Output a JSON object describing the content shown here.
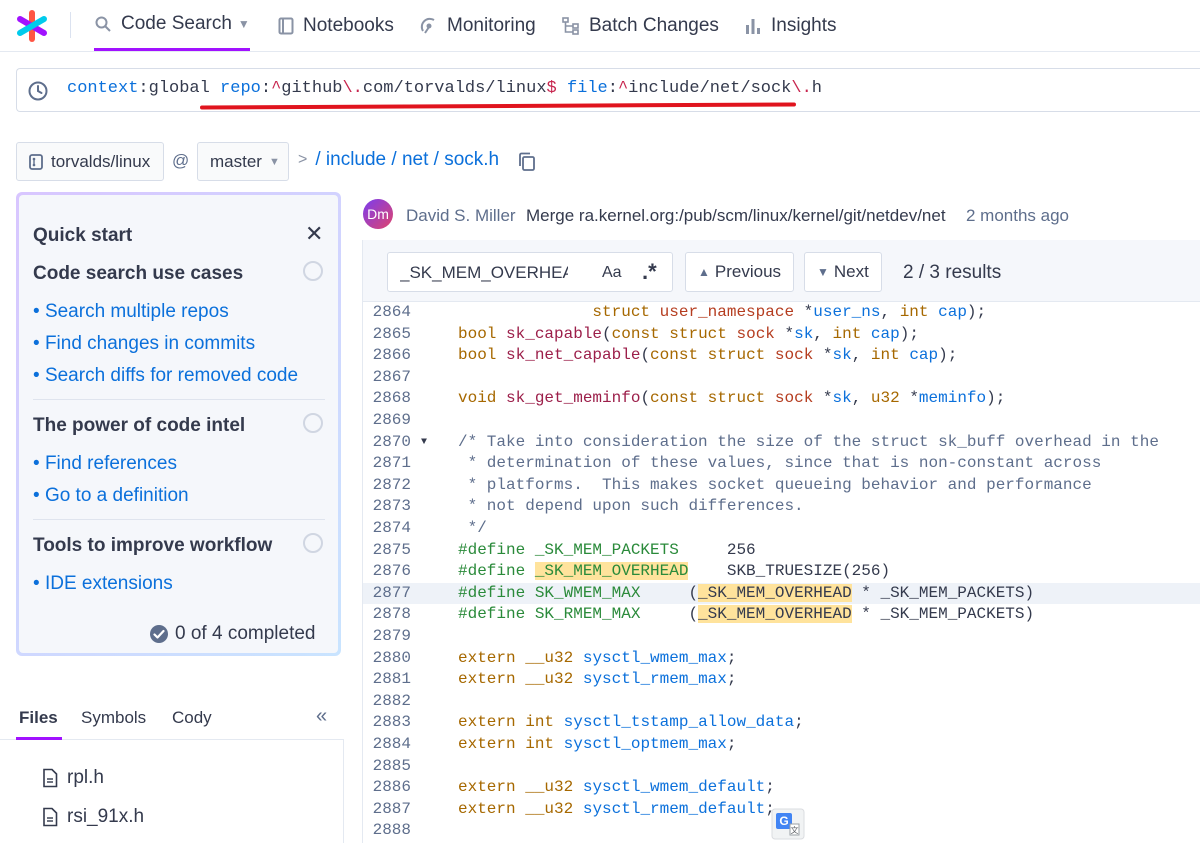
{
  "nav": {
    "items": [
      {
        "label": "Code Search",
        "icon": "search-icon",
        "active": true
      },
      {
        "label": "Notebooks",
        "icon": "notebook-icon"
      },
      {
        "label": "Monitoring",
        "icon": "monitoring-icon"
      },
      {
        "label": "Batch Changes",
        "icon": "batch-changes-icon"
      },
      {
        "label": "Insights",
        "icon": "insights-icon"
      }
    ],
    "accent": "#a112ff"
  },
  "search": {
    "tokens": [
      {
        "text": "context",
        "kind": "key"
      },
      {
        "text": ":global ",
        "kind": "plain"
      },
      {
        "text": "repo",
        "kind": "key"
      },
      {
        "text": ":",
        "kind": "plain"
      },
      {
        "text": "^",
        "kind": "op"
      },
      {
        "text": "github",
        "kind": "plain"
      },
      {
        "text": "\\.",
        "kind": "op"
      },
      {
        "text": "com/torvalds/linux",
        "kind": "plain"
      },
      {
        "text": "$",
        "kind": "op"
      },
      {
        "text": " ",
        "kind": "plain"
      },
      {
        "text": "file",
        "kind": "key"
      },
      {
        "text": ":",
        "kind": "plain"
      },
      {
        "text": "^",
        "kind": "op"
      },
      {
        "text": "include/net/sock",
        "kind": "plain"
      },
      {
        "text": "\\.",
        "kind": "op"
      },
      {
        "text": "h",
        "kind": "plain"
      }
    ]
  },
  "breadcrumb": {
    "repo": "torvalds/linux",
    "at": "@",
    "branch": "master",
    "path": "/ include / net / sock.h"
  },
  "quickstart": {
    "title": "Quick start",
    "sections": [
      {
        "title": "Code search use cases",
        "links": [
          "Search multiple repos",
          "Find changes in commits",
          "Search diffs for removed code"
        ]
      },
      {
        "title": "The power of code intel",
        "links": [
          "Find references",
          "Go to a definition"
        ]
      },
      {
        "title": "Tools to improve workflow",
        "links": [
          "IDE extensions"
        ]
      }
    ],
    "progress": "0 of 4 completed",
    "completed": 0,
    "total": 4
  },
  "left_tabs": [
    "Files",
    "Symbols",
    "Cody"
  ],
  "files": [
    "rpl.h",
    "rsi_91x.h"
  ],
  "commit": {
    "avatar": "Dm",
    "author": "David S. Miller",
    "message": "Merge ra.kernel.org:/pub/scm/linux/kernel/git/netdev/net",
    "date": "2 months ago"
  },
  "find": {
    "value": "_SK_MEM_OVERHEAD",
    "case_label": "Aa",
    "regex_label": ".*",
    "previous": "Previous",
    "next": "Next",
    "results": "2 / 3 results"
  },
  "code": {
    "highlighted_line": 2877,
    "lines": [
      {
        "n": 2864,
        "html": "              <span class=\"k\">struct</span> <span class=\"t\">user_namespace</span> *<span class=\"v\">user_ns</span>, <span class=\"k\">int</span> <span class=\"v\">cap</span>);"
      },
      {
        "n": 2865,
        "html": "<span class=\"k\">bool</span> <span class=\"f\">sk_capable</span>(<span class=\"k\">const</span> <span class=\"k\">struct</span> <span class=\"t\">sock</span> *<span class=\"v\">sk</span>, <span class=\"k\">int</span> <span class=\"v\">cap</span>);"
      },
      {
        "n": 2866,
        "html": "<span class=\"k\">bool</span> <span class=\"f\">sk_net_capable</span>(<span class=\"k\">const</span> <span class=\"k\">struct</span> <span class=\"t\">sock</span> *<span class=\"v\">sk</span>, <span class=\"k\">int</span> <span class=\"v\">cap</span>);"
      },
      {
        "n": 2867,
        "html": ""
      },
      {
        "n": 2868,
        "html": "<span class=\"k\">void</span> <span class=\"f\">sk_get_meminfo</span>(<span class=\"k\">const</span> <span class=\"k\">struct</span> <span class=\"t\">sock</span> *<span class=\"v\">sk</span>, <span class=\"k\">u32</span> *<span class=\"v\">meminfo</span>);"
      },
      {
        "n": 2869,
        "html": ""
      },
      {
        "n": 2870,
        "fold": true,
        "html": "<span class=\"c\">/* Take into consideration the size of the struct sk_buff overhead in the</span>"
      },
      {
        "n": 2871,
        "html": "<span class=\"c\"> * determination of these values, since that is non-constant across</span>"
      },
      {
        "n": 2872,
        "html": "<span class=\"c\"> * platforms.  This makes socket queueing behavior and performance</span>"
      },
      {
        "n": 2873,
        "html": "<span class=\"c\"> * not depend upon such differences.</span>"
      },
      {
        "n": 2874,
        "html": "<span class=\"c\"> */</span>"
      },
      {
        "n": 2875,
        "html": "<span class=\"d\">#define _SK_MEM_PACKETS</span>     256"
      },
      {
        "n": 2876,
        "html": "<span class=\"d\">#define <span class=\"mark\">_SK_MEM_OVERHEAD</span></span>    SKB_TRUESIZE(256)"
      },
      {
        "n": 2877,
        "html": "<span class=\"d\">#define SK_WMEM_MAX</span>     (<span class=\"mark\">_SK_MEM_OVERHEAD</span> * _SK_MEM_PACKETS)"
      },
      {
        "n": 2878,
        "html": "<span class=\"d\">#define SK_RMEM_MAX</span>     (<span class=\"mark\">_SK_MEM_OVERHEAD</span> * _SK_MEM_PACKETS)"
      },
      {
        "n": 2879,
        "html": ""
      },
      {
        "n": 2880,
        "html": "<span class=\"k\">extern</span> <span class=\"k\">__u32</span> <span class=\"v\">sysctl_wmem_max</span>;"
      },
      {
        "n": 2881,
        "html": "<span class=\"k\">extern</span> <span class=\"k\">__u32</span> <span class=\"v\">sysctl_rmem_max</span>;"
      },
      {
        "n": 2882,
        "html": ""
      },
      {
        "n": 2883,
        "html": "<span class=\"k\">extern</span> <span class=\"k\">int</span> <span class=\"v\">sysctl_tstamp_allow_data</span>;"
      },
      {
        "n": 2884,
        "html": "<span class=\"k\">extern</span> <span class=\"k\">int</span> <span class=\"v\">sysctl_optmem_max</span>;"
      },
      {
        "n": 2885,
        "html": ""
      },
      {
        "n": 2886,
        "html": "<span class=\"k\">extern</span> <span class=\"k\">__u32</span> <span class=\"v\">sysctl_wmem_default</span>;"
      },
      {
        "n": 2887,
        "html": "<span class=\"k\">extern</span> <span class=\"k\">__u32</span> <span class=\"v\">sysctl_rmem_default</span>;"
      },
      {
        "n": 2888,
        "html": ""
      }
    ]
  },
  "colors": {
    "link": "#0b70db",
    "highlight": "#ffe39c",
    "underline_red": "#e0141e"
  }
}
